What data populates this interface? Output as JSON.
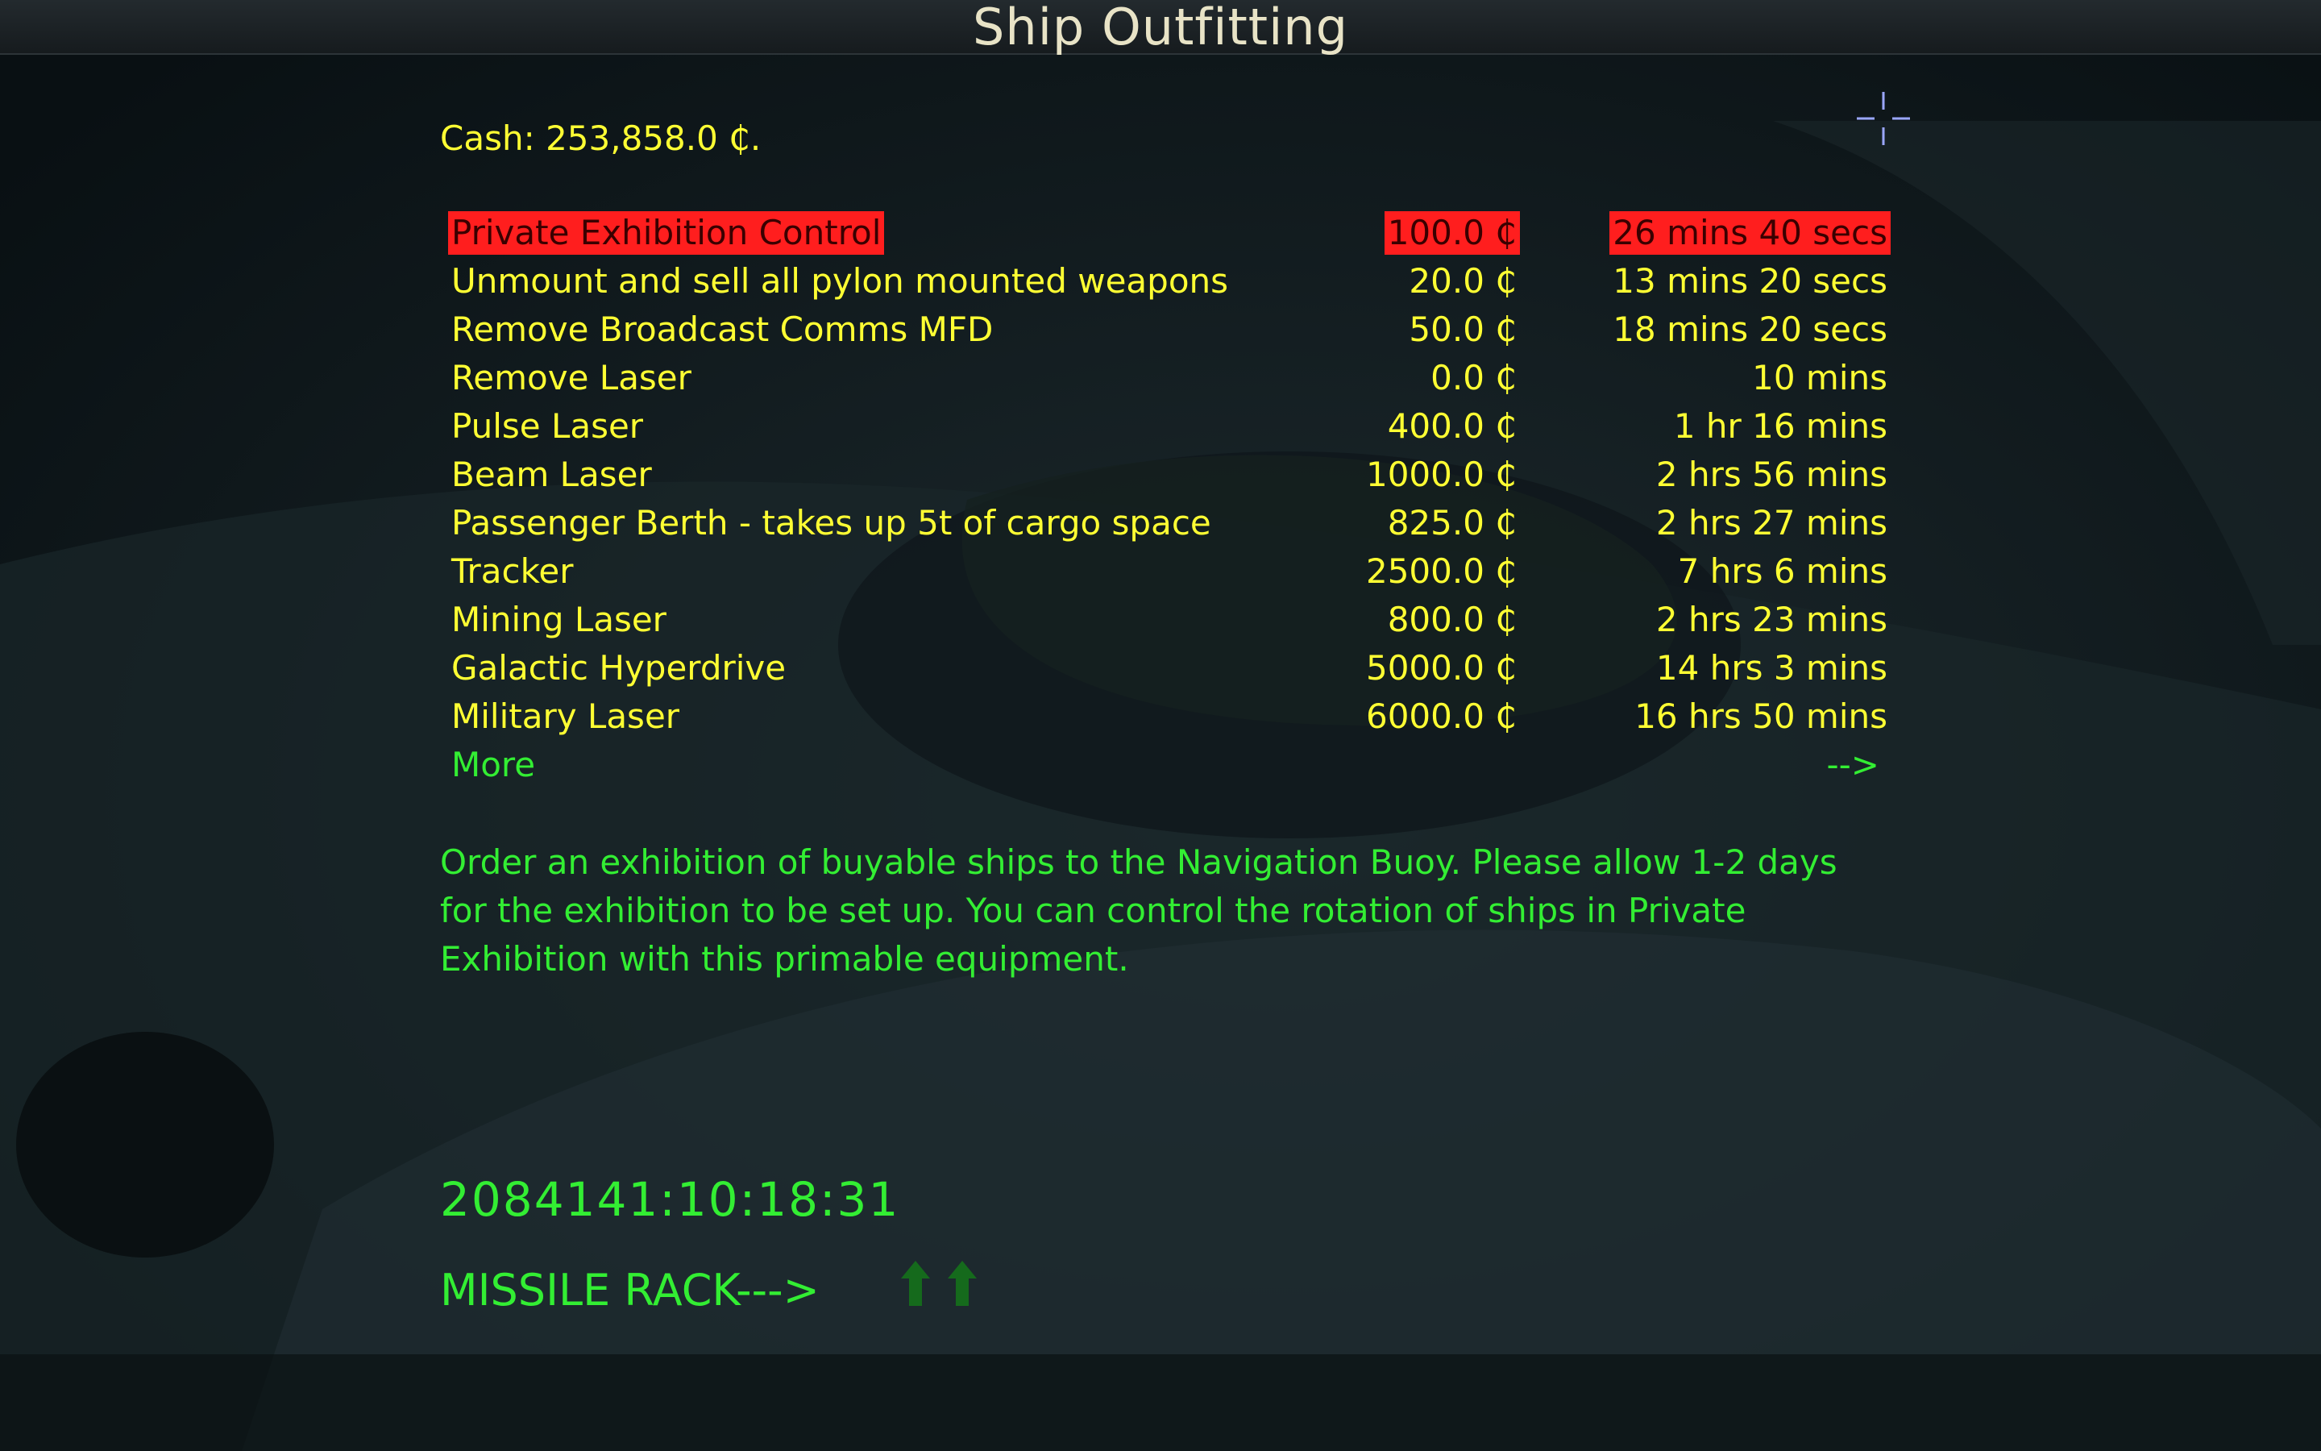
{
  "window": {
    "title": "Ship Outfitting"
  },
  "cash": {
    "text": "Cash: 253,858.0 ₵."
  },
  "equipment": [
    {
      "name": "Private Exhibition Control",
      "price": "100.0 ₵",
      "time": "26 mins 40 secs",
      "selected": true
    },
    {
      "name": "Unmount and sell all pylon mounted weapons",
      "price": "20.0 ₵",
      "time": "13 mins 20 secs"
    },
    {
      "name": "Remove Broadcast Comms MFD",
      "price": "50.0 ₵",
      "time": "18 mins 20 secs"
    },
    {
      "name": "Remove Laser",
      "price": "0.0 ₵",
      "time": "10 mins"
    },
    {
      "name": "Pulse Laser",
      "price": "400.0 ₵",
      "time": "1 hr 16 mins"
    },
    {
      "name": "Beam Laser",
      "price": "1000.0 ₵",
      "time": "2 hrs 56 mins"
    },
    {
      "name": "Passenger Berth - takes up 5t of cargo space",
      "price": "825.0 ₵",
      "time": "2 hrs 27 mins"
    },
    {
      "name": "Tracker",
      "price": "2500.0 ₵",
      "time": "7 hrs 6 mins"
    },
    {
      "name": "Mining Laser",
      "price": "800.0 ₵",
      "time": "2 hrs 23 mins"
    },
    {
      "name": "Galactic Hyperdrive",
      "price": "5000.0 ₵",
      "time": "14 hrs 3 mins"
    },
    {
      "name": "Military Laser",
      "price": "6000.0 ₵",
      "time": "16 hrs 50 mins"
    }
  ],
  "more": {
    "label": "More",
    "arrow": "-->"
  },
  "description": "Order an exhibition of buyable ships to the Navigation Buoy. Please allow 1-2 days for the exhibition to be set up. You can control the rotation of ships in Private Exhibition with this primable equipment.",
  "clock": "2084141:10:18:31",
  "missile_rack": {
    "label": "MISSILE RACK--->"
  },
  "icons": {
    "cursor": "crosshair-icon",
    "weapons": "up-arrows-icon"
  },
  "colors": {
    "text_yellow": "#ffff33",
    "text_green": "#33ee33",
    "highlight_red": "#ff1e1e",
    "title_text": "#e8e3c6"
  }
}
